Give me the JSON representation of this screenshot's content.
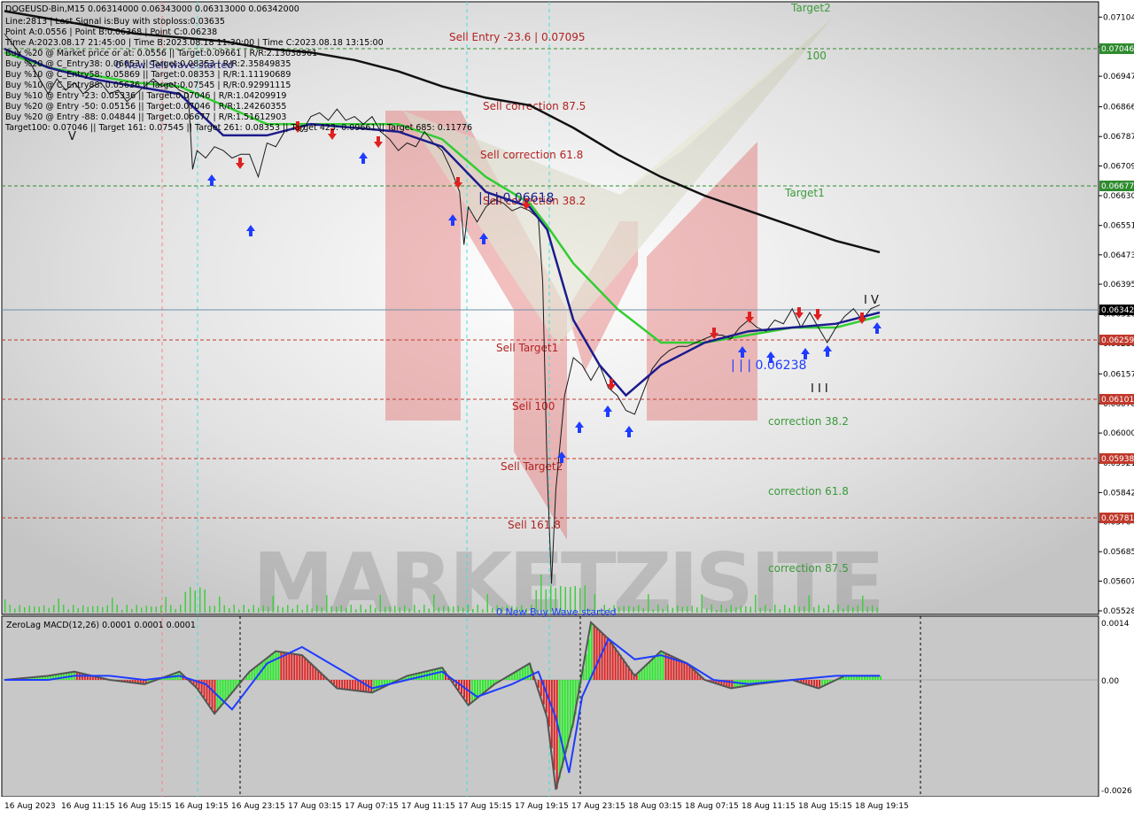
{
  "header": {
    "symbol_line": "DOGEUSD-Bin,M15  0.06314000 0.06343000 0.06313000 0.06342000",
    "info_lines": [
      "Line:2813 | Last Signal is:Buy with stoploss:0.03635",
      "Point A:0.0556 | Point B:0.06368 | Point C:0.06238",
      "Time A:2023.08.17 21:45:00 | Time B:2023.08.18 11:30:00 | Time C:2023.08.18 13:15:00",
      "Buy %20 @ Market price or at: 0.0556 || Target:0.09661 | R/R:2.13038961",
      "Buy %20 @ C_Entry38: 0.06053 || Target:0.08353 | R/R:2.35849835",
      "Buy %10 @ C_Entry58: 0.05869 || Target:0.08353 | R/R:1.11190689",
      "Buy %10 @ C_Entry88: 0.05636 || Target:0.07545 | R/R:0.92991115",
      "Buy %10 @ Entry -23: 0.05336 || Target:0.07046 | R/R:1.04209919",
      "Buy %20 @ Entry -50: 0.05156 || Target:0.07046 | R/R:1.24260355",
      "Buy %20 @ Entry -88: 0.04844 || Target:0.06677 | R/R:1.51612903",
      "Target100: 0.07046 || Target 161: 0.07545 || Target 261: 0.08353 || Target 423: 0.09661 || Target 685: 0.11776"
    ]
  },
  "overlay_labels": {
    "new_sell_wave": "0 New Sell wave started",
    "new_buy_wave": "0 New Buy Wave started",
    "point_b": "| | | 0.06618",
    "point_c": "| | | 0.06238",
    "mark_iv": "I V",
    "mark_iii": "I I I",
    "mark_v": "V"
  },
  "watermark": {
    "text": "MARKETZISITE"
  },
  "main_price_axis": {
    "ticks": [
      "0.07104",
      "0.07025",
      "0.06947",
      "0.06866",
      "0.06787",
      "0.06709",
      "0.06630",
      "0.06551",
      "0.06473",
      "0.06395",
      "0.06316",
      "0.06238",
      "0.06157",
      "0.06078",
      "0.06000",
      "0.05921",
      "0.05842",
      "0.05764",
      "0.05685",
      "0.05607",
      "0.05528"
    ],
    "current": "0.06342",
    "badges": [
      {
        "text": "0.07046",
        "color": "#2e8b2e"
      },
      {
        "text": "0.06677",
        "color": "#2e8b2e"
      },
      {
        "text": "0.06259",
        "color": "#c0392b"
      },
      {
        "text": "0.06101",
        "color": "#c0392b"
      },
      {
        "text": "0.05938",
        "color": "#c0392b"
      },
      {
        "text": "0.05781",
        "color": "#c0392b"
      }
    ]
  },
  "levels": [
    {
      "label": "Target2",
      "color": "#3a9a3a"
    },
    {
      "label": "100",
      "color": "#3a9a3a"
    },
    {
      "label": "Sell Entry -23.6 | 0.07095",
      "color": "#b22222"
    },
    {
      "label": "Sell correction 87.5",
      "color": "#b22222"
    },
    {
      "label": "Sell correction 61.8",
      "color": "#b22222"
    },
    {
      "label": "Target1",
      "color": "#3a9a3a"
    },
    {
      "label": "Sell correction 38.2",
      "color": "#b22222"
    },
    {
      "label": "Sell Target1",
      "color": "#b22222"
    },
    {
      "label": "Sell 100",
      "color": "#b22222"
    },
    {
      "label": "Sell Target2",
      "color": "#b22222"
    },
    {
      "label": "Sell 161.8",
      "color": "#b22222"
    },
    {
      "label": "correction 38.2",
      "color": "#3a9a3a"
    },
    {
      "label": "correction 61.8",
      "color": "#3a9a3a"
    },
    {
      "label": "correction 87.5",
      "color": "#3a9a3a"
    }
  ],
  "time_axis": {
    "labels": [
      "16 Aug 2023",
      "16 Aug 11:15",
      "16 Aug 15:15",
      "16 Aug 19:15",
      "16 Aug 23:15",
      "17 Aug 03:15",
      "17 Aug 07:15",
      "17 Aug 11:15",
      "17 Aug 15:15",
      "17 Aug 19:15",
      "17 Aug 23:15",
      "18 Aug 03:15",
      "18 Aug 07:15",
      "18 Aug 11:15",
      "18 Aug 15:15",
      "18 Aug 19:15"
    ]
  },
  "macd_panel": {
    "title": "ZeroLag MACD(12,26) 0.0001 0.0001 0.0001",
    "ticks": [
      "0.0014",
      "0.00",
      "-0.0026"
    ]
  },
  "chart_data": {
    "type": "line",
    "ylim": [
      0.05528,
      0.0714
    ],
    "price_path": {
      "x": [
        0.0,
        0.01,
        0.02,
        0.03,
        0.04,
        0.05,
        0.06,
        0.07,
        0.08,
        0.09,
        0.1,
        0.11,
        0.12,
        0.13,
        0.14,
        0.15,
        0.16,
        0.17,
        0.18,
        0.19,
        0.2,
        0.21,
        0.215,
        0.22,
        0.23,
        0.24,
        0.25,
        0.26,
        0.27,
        0.28,
        0.29,
        0.3,
        0.31,
        0.32,
        0.33,
        0.34,
        0.35,
        0.36,
        0.37,
        0.38,
        0.39,
        0.4,
        0.41,
        0.42,
        0.43,
        0.44,
        0.45,
        0.46,
        0.47,
        0.48,
        0.49,
        0.5,
        0.51,
        0.52,
        0.525,
        0.53,
        0.54,
        0.55,
        0.56,
        0.57,
        0.58,
        0.59,
        0.6,
        0.61,
        0.615,
        0.62,
        0.625,
        0.63,
        0.64,
        0.65,
        0.66,
        0.67,
        0.68,
        0.69,
        0.7,
        0.71,
        0.72,
        0.73,
        0.74,
        0.75,
        0.76,
        0.77,
        0.78,
        0.79,
        0.8,
        0.81,
        0.82,
        0.83,
        0.84,
        0.85,
        0.86,
        0.87,
        0.88,
        0.89,
        0.9,
        0.91,
        0.92,
        0.93,
        0.94,
        0.95,
        0.96,
        0.97,
        0.98,
        0.99,
        1.0
      ],
      "y": [
        0.0706,
        0.0703,
        0.07,
        0.0698,
        0.0694,
        0.069,
        0.0694,
        0.0691,
        0.0693,
        0.069,
        0.0692,
        0.0693,
        0.069,
        0.0691,
        0.0688,
        0.069,
        0.0692,
        0.0694,
        0.0692,
        0.0693,
        0.0691,
        0.069,
        0.067,
        0.0675,
        0.0673,
        0.0676,
        0.0675,
        0.0673,
        0.0674,
        0.0674,
        0.0668,
        0.0677,
        0.0676,
        0.068,
        0.0681,
        0.068,
        0.0684,
        0.0685,
        0.0683,
        0.0686,
        0.0683,
        0.0684,
        0.0682,
        0.0684,
        0.068,
        0.0678,
        0.0675,
        0.0677,
        0.0676,
        0.068,
        0.0677,
        0.0675,
        0.067,
        0.0664,
        0.065,
        0.066,
        0.0656,
        0.066,
        0.0662,
        0.0661,
        0.0659,
        0.066,
        0.0659,
        0.0657,
        0.064,
        0.059,
        0.056,
        0.0585,
        0.061,
        0.062,
        0.0618,
        0.0614,
        0.0618,
        0.0612,
        0.061,
        0.0606,
        0.0605,
        0.0611,
        0.0617,
        0.062,
        0.0622,
        0.0623,
        0.0623,
        0.0624,
        0.0625,
        0.0626,
        0.0626,
        0.0625,
        0.0628,
        0.063,
        0.0628,
        0.0627,
        0.063,
        0.0629,
        0.0633,
        0.0628,
        0.0632,
        0.0628,
        0.0624,
        0.0628,
        0.0631,
        0.0633,
        0.063,
        0.0633,
        0.0634
      ]
    },
    "ma_black": {
      "x": [
        0.0,
        0.05,
        0.1,
        0.15,
        0.2,
        0.25,
        0.3,
        0.35,
        0.4,
        0.45,
        0.5,
        0.55,
        0.6,
        0.65,
        0.7,
        0.75,
        0.8,
        0.85,
        0.9,
        0.95,
        1.0
      ],
      "y": [
        0.0712,
        0.071,
        0.0708,
        0.0706,
        0.0705,
        0.0704,
        0.0702,
        0.0701,
        0.0699,
        0.0696,
        0.0692,
        0.0689,
        0.0687,
        0.0681,
        0.0674,
        0.0668,
        0.0663,
        0.0659,
        0.0655,
        0.0651,
        0.0648
      ]
    },
    "ma_green": {
      "x": [
        0.0,
        0.05,
        0.1,
        0.15,
        0.2,
        0.25,
        0.3,
        0.35,
        0.4,
        0.45,
        0.5,
        0.55,
        0.6,
        0.62,
        0.65,
        0.7,
        0.75,
        0.8,
        0.85,
        0.9,
        0.95,
        1.0
      ],
      "y": [
        0.0701,
        0.0697,
        0.0695,
        0.0693,
        0.0692,
        0.0687,
        0.0682,
        0.0682,
        0.0682,
        0.0682,
        0.0678,
        0.0668,
        0.0661,
        0.0655,
        0.0645,
        0.0633,
        0.0624,
        0.0624,
        0.0626,
        0.0628,
        0.0628,
        0.0631
      ]
    },
    "ma_navy": {
      "x": [
        0.0,
        0.05,
        0.1,
        0.15,
        0.2,
        0.25,
        0.3,
        0.35,
        0.4,
        0.45,
        0.5,
        0.55,
        0.6,
        0.62,
        0.65,
        0.68,
        0.71,
        0.75,
        0.8,
        0.85,
        0.9,
        0.95,
        1.0
      ],
      "y": [
        0.0702,
        0.0697,
        0.0694,
        0.0692,
        0.069,
        0.0679,
        0.0679,
        0.0682,
        0.0681,
        0.068,
        0.0676,
        0.0664,
        0.066,
        0.0654,
        0.063,
        0.0618,
        0.061,
        0.0618,
        0.0624,
        0.0627,
        0.0628,
        0.0629,
        0.0632
      ]
    },
    "macd_hist": {
      "x": [
        0.0,
        0.05,
        0.08,
        0.12,
        0.16,
        0.2,
        0.22,
        0.24,
        0.28,
        0.31,
        0.34,
        0.38,
        0.42,
        0.46,
        0.5,
        0.53,
        0.56,
        0.6,
        0.62,
        0.63,
        0.65,
        0.67,
        0.69,
        0.72,
        0.75,
        0.78,
        0.8,
        0.83,
        0.86,
        0.9,
        0.93,
        0.96,
        1.0
      ],
      "y": [
        0.0,
        0.0001,
        0.0002,
        0.0,
        -0.0001,
        0.0002,
        -0.0002,
        -0.0008,
        0.0002,
        0.0007,
        0.0006,
        -0.0002,
        -0.0003,
        0.0001,
        0.0003,
        -0.0006,
        -0.0001,
        0.0004,
        -0.0009,
        -0.0026,
        -0.001,
        0.0014,
        0.001,
        0.0001,
        0.0007,
        0.0004,
        0.0,
        -0.0002,
        -0.0001,
        0.0,
        -0.0002,
        0.0001,
        0.0001
      ]
    },
    "macd_signal": {
      "x": [
        0.0,
        0.05,
        0.08,
        0.12,
        0.16,
        0.2,
        0.23,
        0.26,
        0.3,
        0.34,
        0.38,
        0.42,
        0.46,
        0.5,
        0.54,
        0.58,
        0.61,
        0.63,
        0.645,
        0.66,
        0.69,
        0.72,
        0.75,
        0.78,
        0.81,
        0.85,
        0.9,
        0.95,
        1.0
      ],
      "y": [
        0.0,
        0.0,
        0.0001,
        0.0001,
        0.0,
        0.0001,
        -0.0001,
        -0.0007,
        0.0004,
        0.0008,
        0.0003,
        -0.0002,
        0.0,
        0.0002,
        -0.0004,
        -0.0001,
        0.0002,
        -0.0009,
        -0.0022,
        -0.0004,
        0.001,
        0.0005,
        0.0006,
        0.0004,
        0.0,
        -0.0001,
        0.0,
        0.0001,
        0.0001
      ]
    }
  }
}
